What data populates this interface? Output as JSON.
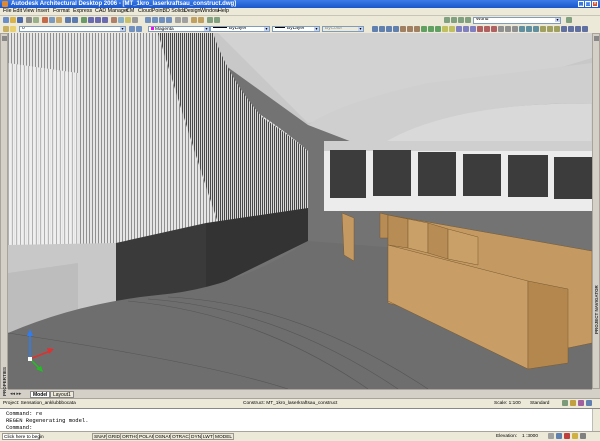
{
  "window": {
    "title": "Autodesk Architectural Desktop 2006 - [MT_1kro_laserkraftsau_construct.dwg]",
    "colors": {
      "titlebar": "#2359d0",
      "chrome": "#ece9d8",
      "viewport_bg": "#737373",
      "wood": "#c49a62"
    }
  },
  "menubar": {
    "items": [
      "File",
      "Edit",
      "View",
      "Insert",
      "Format",
      "Express",
      "CAD Manager",
      "CM",
      "CloudPoint",
      "3D Solids",
      "Design",
      "Window",
      "Help"
    ]
  },
  "toolbar": {
    "ucs_combo": "World",
    "layer_combo": "0",
    "color_combo": "Magenta",
    "linetype_combo": "ByLayer",
    "lineweight_combo": "ByLayer",
    "plotstyle_combo": "ByColor"
  },
  "palettes": {
    "left_label": "PROPERTIES",
    "right_label": "PROJECT NAVIGATOR"
  },
  "layout_tabs": [
    "Model",
    "Layout1"
  ],
  "drawing_status": {
    "project": "Project: Sensation_anklubbbocata",
    "construct": "Construct: MT_1kro_laserkraftsau_construct",
    "scale": "Scale: 1:100",
    "display_config": "Standard"
  },
  "command_history": [
    "Command: re",
    "REGEN Regenerating model.",
    "Command:"
  ],
  "statusbar": {
    "hint": "Click here to begin",
    "toggles": [
      "SNAP",
      "GRID",
      "ORTHO",
      "POLAR",
      "OSNAP",
      "OTRACK",
      "DYN",
      "LWT",
      "MODEL"
    ],
    "elevation": "Elevation:",
    "elevation_value": "1 :3000"
  },
  "icons": [
    "autocad-app-icon",
    "minimize-icon",
    "maximize-icon",
    "close-icon",
    "ucs-axis-icon",
    "palette-toggle-icon"
  ]
}
